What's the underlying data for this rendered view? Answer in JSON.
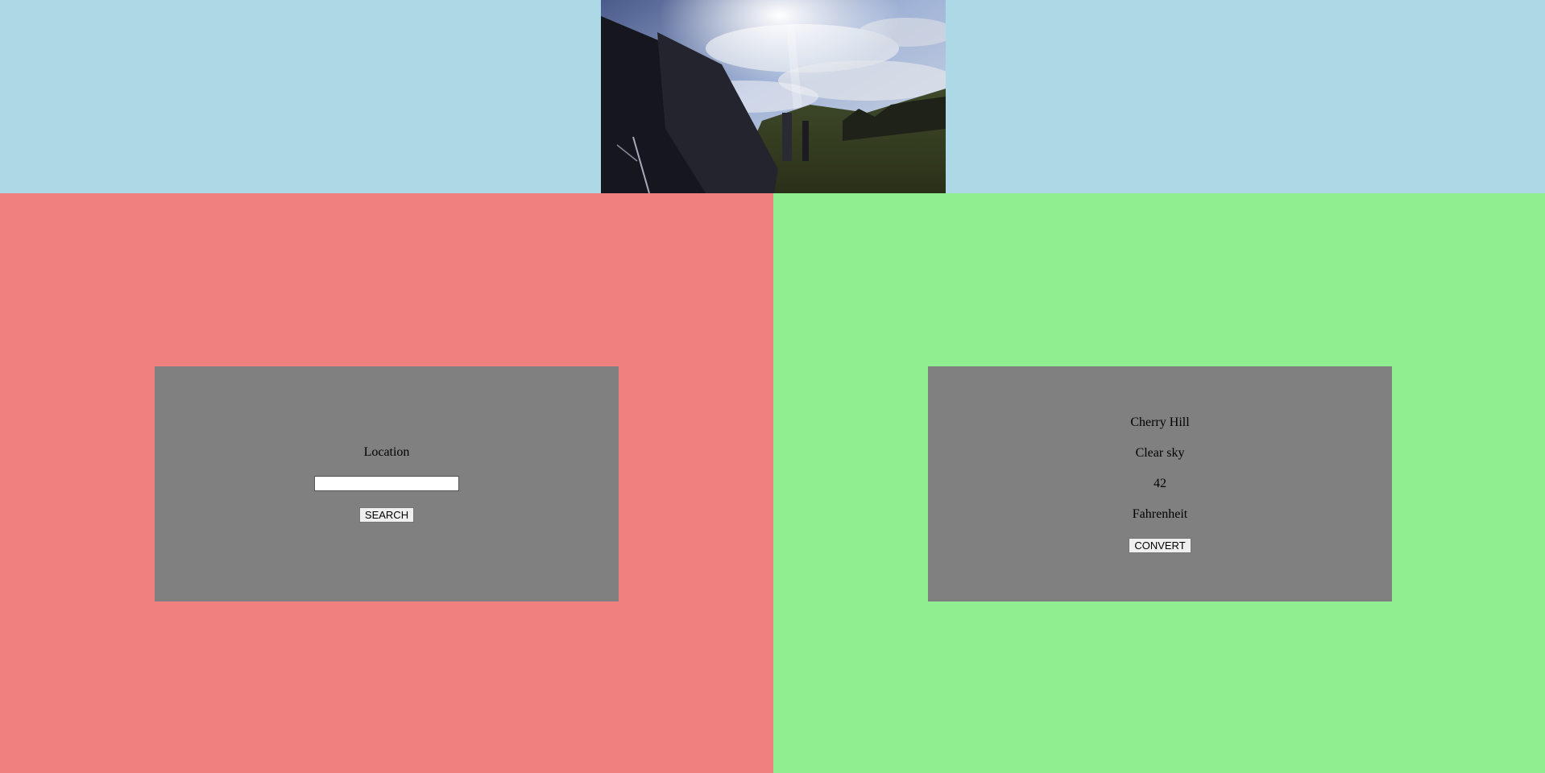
{
  "search": {
    "label": "Location",
    "input_value": "",
    "input_placeholder": "",
    "button_label": "SEARCH"
  },
  "weather": {
    "city": "Cherry Hill",
    "condition": "Clear sky",
    "temperature": "42",
    "unit": "Fahrenheit",
    "button_label": "CONVERT"
  },
  "colors": {
    "banner": "#add8e6",
    "left_panel": "#f08080",
    "right_panel": "#90ee90",
    "card": "#808080"
  },
  "icons": {
    "header_photo": "sky-photo"
  }
}
